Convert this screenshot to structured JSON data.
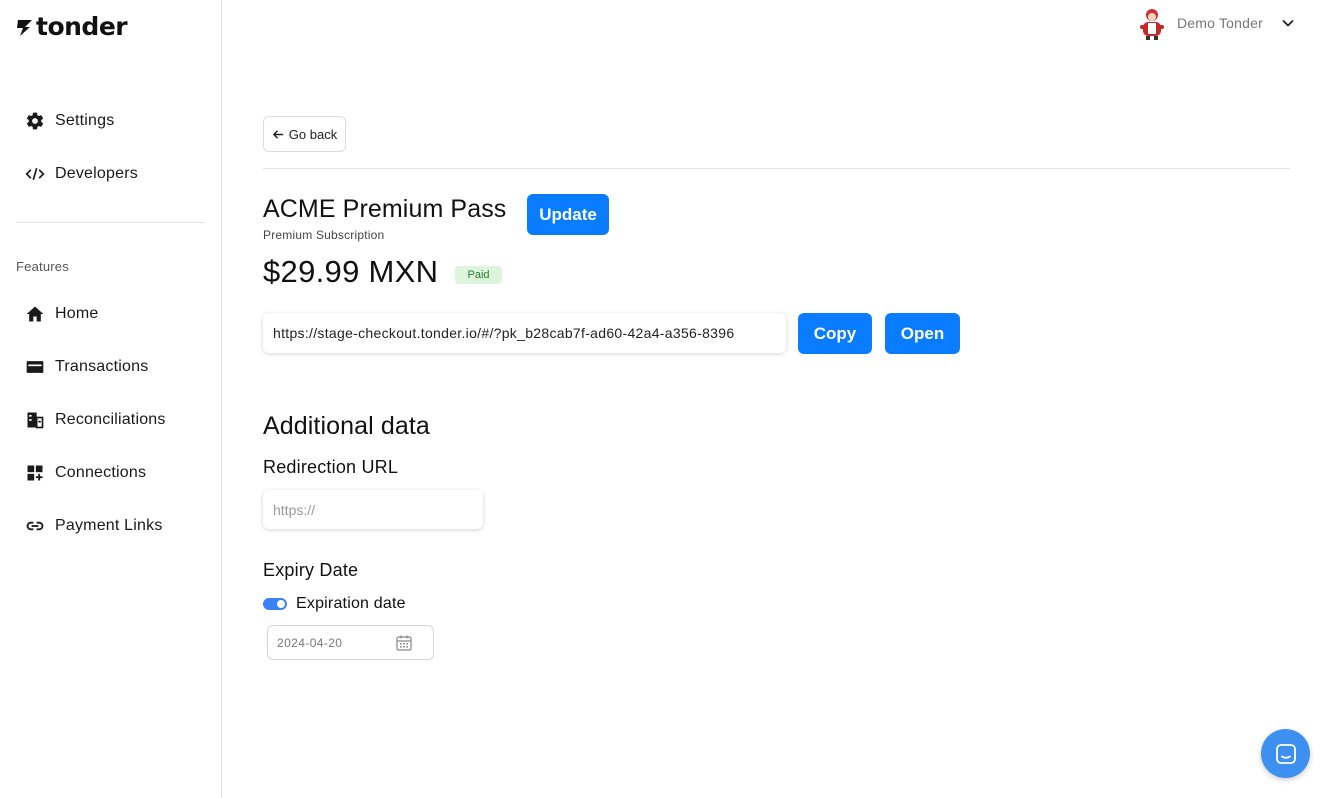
{
  "brand": {
    "name": "tonder"
  },
  "sidebar": {
    "top_items": [
      {
        "label": "Settings",
        "icon": "gear-icon"
      },
      {
        "label": "Developers",
        "icon": "code-icon"
      }
    ],
    "section_label": "Features",
    "feature_items": [
      {
        "label": "Home",
        "icon": "home-icon"
      },
      {
        "label": "Transactions",
        "icon": "card-icon"
      },
      {
        "label": "Reconciliations",
        "icon": "reconcile-icon"
      },
      {
        "label": "Connections",
        "icon": "widgets-icon"
      },
      {
        "label": "Payment Links",
        "icon": "link-icon"
      }
    ]
  },
  "user": {
    "name": "Demo Tonder"
  },
  "main": {
    "back_label": "Go back",
    "title": "ACME Premium Pass",
    "subtitle": "Premium Subscription",
    "update_label": "Update",
    "price": "$29.99 MXN",
    "status_badge": "Paid",
    "payment_link": "https://stage-checkout.tonder.io/#/?pk_b28cab7f-ad60-42a4-a356-8396",
    "copy_label": "Copy",
    "open_label": "Open",
    "additional_heading": "Additional data",
    "redirection_label": "Redirection URL",
    "redirection_placeholder": "https://",
    "expiry_heading": "Expiry Date",
    "expiration_toggle_label": "Expiration date",
    "expiration_enabled": true,
    "expiration_date": "2024-04-20"
  },
  "colors": {
    "primary": "#0a7cff",
    "badge_bg": "#dcf5dc",
    "badge_text": "#2e7d32",
    "toggle": "#3b82f6",
    "chat": "#3d8ff0"
  }
}
